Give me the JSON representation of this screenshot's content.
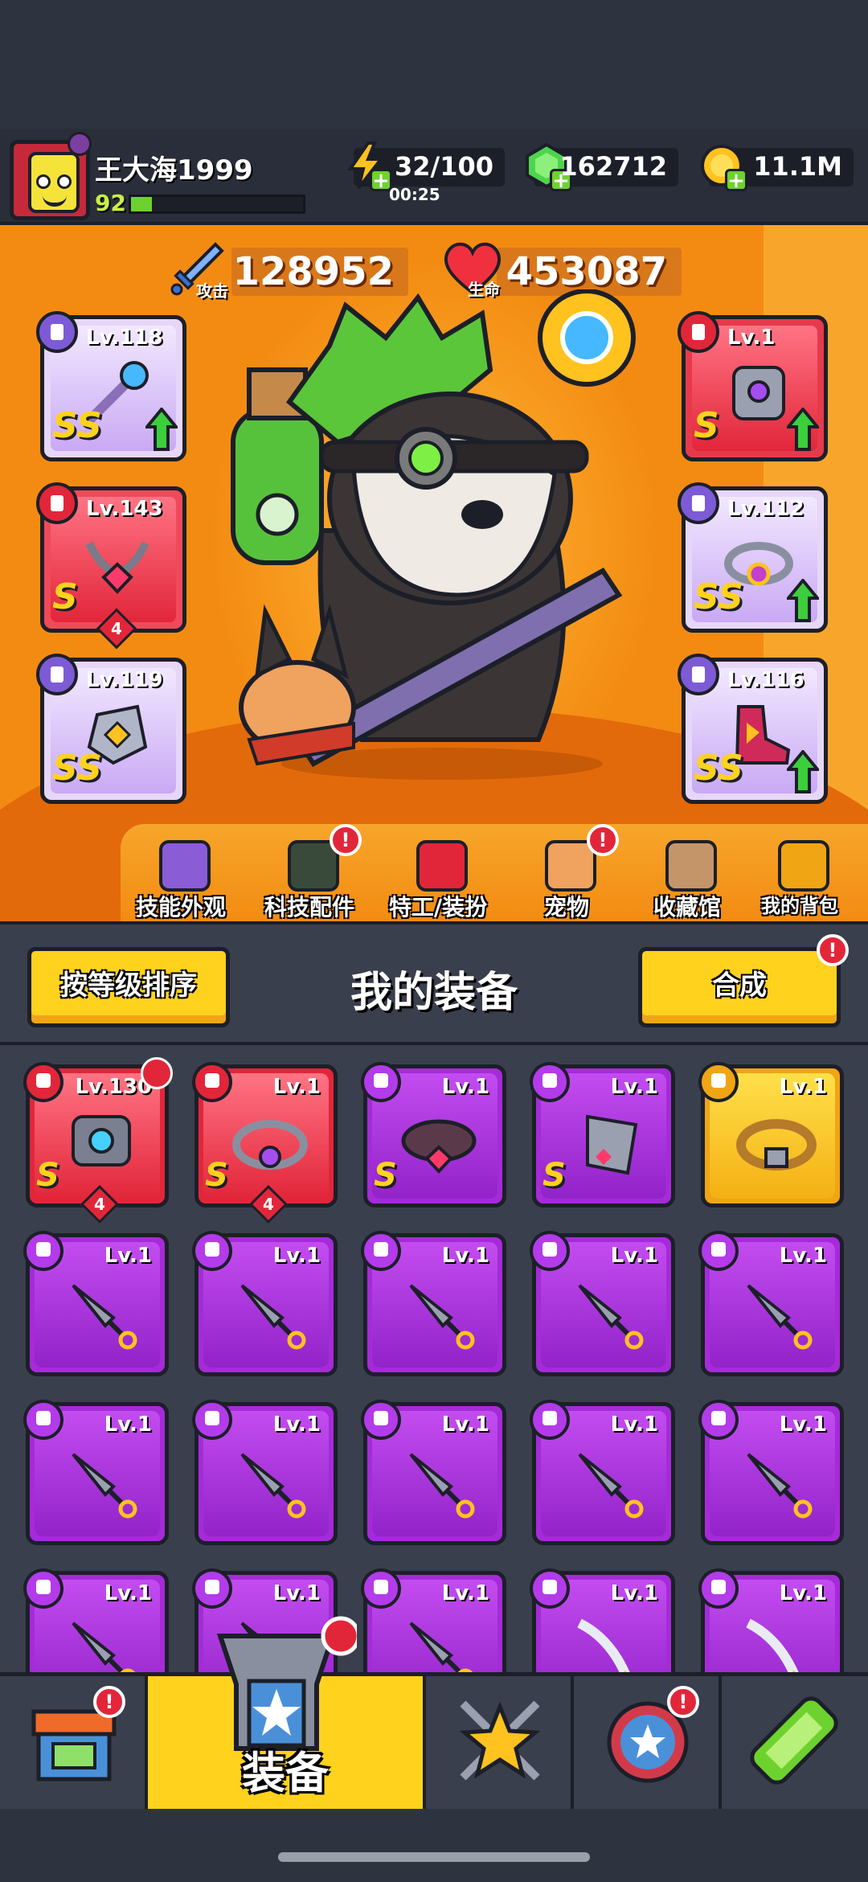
{
  "player": {
    "name": "王大海1999",
    "level": "92",
    "xp_fraction": 0.12
  },
  "resources": {
    "energy": "32/100",
    "energy_timer": "00:25",
    "gems": "162712",
    "coins": "11.1M"
  },
  "stats": {
    "attack_label": "攻击",
    "attack_value": "128952",
    "hp_label": "生命",
    "hp_value": "453087"
  },
  "equipped": {
    "left": [
      {
        "level": "Lv.118",
        "rank": "SS",
        "upgrade": true
      },
      {
        "level": "Lv.143",
        "rank": "S",
        "count": "4"
      },
      {
        "level": "Lv.119",
        "rank": "SS"
      }
    ],
    "right": [
      {
        "level": "Lv.1",
        "rank": "S",
        "upgrade": true
      },
      {
        "level": "Lv.112",
        "rank": "SS",
        "upgrade": true
      },
      {
        "level": "Lv.116",
        "rank": "SS",
        "upgrade": true
      }
    ]
  },
  "hero_nav": [
    {
      "label": "技能外观",
      "icon": "skin-icon"
    },
    {
      "label": "科技配件",
      "icon": "tech-icon",
      "alert": "!"
    },
    {
      "label": "特工/装扮",
      "icon": "agent-icon"
    },
    {
      "label": "宠物",
      "icon": "pet-icon",
      "alert": "!"
    },
    {
      "label": "收藏馆",
      "icon": "collection-icon"
    },
    {
      "label": "我的背包",
      "icon": "backpack-icon"
    }
  ],
  "section": {
    "sort_button": "按等级排序",
    "title": "我的装备",
    "merge_button": "合成",
    "merge_alert": "!"
  },
  "inventory": {
    "row1": [
      {
        "level": "Lv.130",
        "rank": "S",
        "count": "4"
      },
      {
        "level": "Lv.1",
        "rank": "S",
        "count": "4"
      },
      {
        "level": "Lv.1",
        "rank": "S"
      },
      {
        "level": "Lv.1",
        "rank": "S"
      },
      {
        "level": "Lv.1"
      }
    ],
    "generic_level": "Lv.1"
  },
  "bottom_nav": {
    "shop_alert": "!",
    "equip_label": "装备",
    "talent_alert": "!"
  },
  "colors": {
    "hero_bg": "#f38b12",
    "accent_yellow": "#ffd21e",
    "purple_item": "#a52bd8",
    "red_item": "#e2263a",
    "alert_red": "#e2263a"
  }
}
